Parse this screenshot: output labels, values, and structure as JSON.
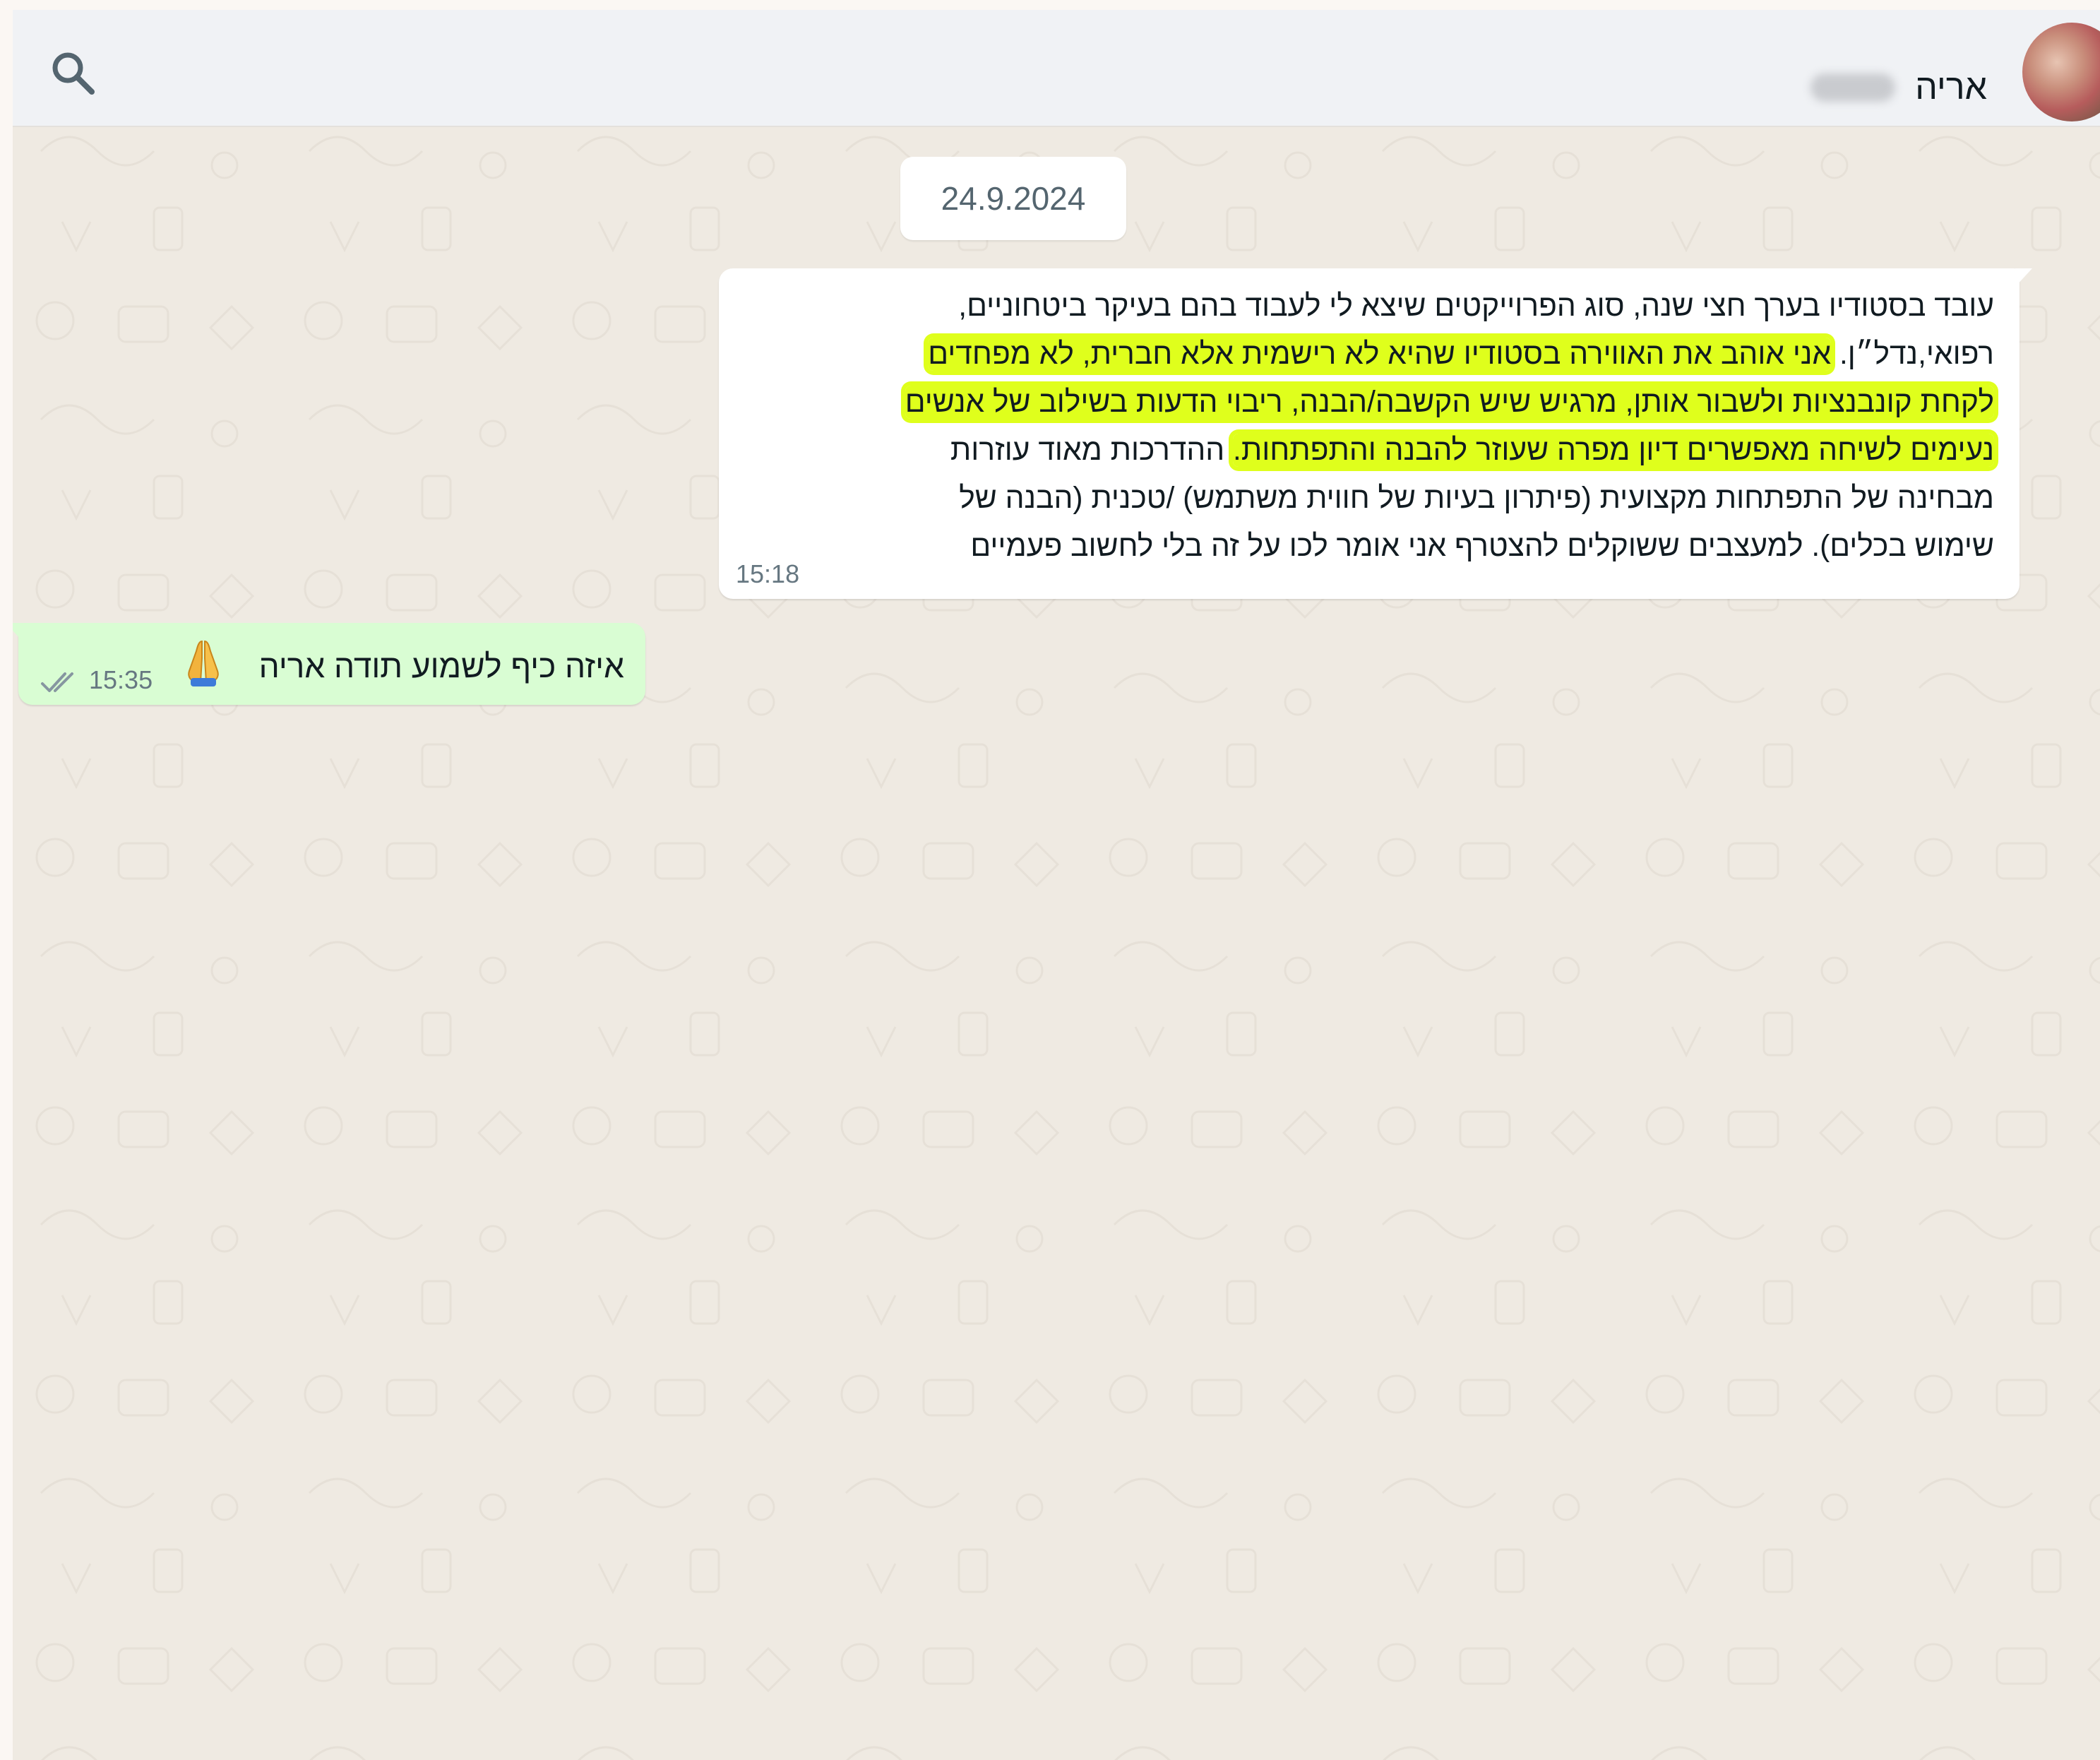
{
  "header": {
    "contact_name": "אריה",
    "search_icon": "search-icon",
    "avatar": "contact-avatar"
  },
  "chat": {
    "date_separator": "24.9.2024",
    "incoming_message": {
      "lines": [
        [
          {
            "text": "עובד בסטודיו בערך חצי שנה, סוג הפרוייקטים שיצא לי לעבוד בהם בעיקר ביטחוניים,",
            "highlight": false
          }
        ],
        [
          {
            "text": "רפואי,נדל״ן. ",
            "highlight": false
          },
          {
            "text": "אני אוהב את האווירה בסטודיו שהיא לא רישמית אלא חברית, לא מפחדים",
            "highlight": true
          }
        ],
        [
          {
            "text": "לקחת קונבנציות ולשבור אותן, מרגיש שיש הקשבה/הבנה, ריבוי הדעות בשילוב של אנשים",
            "highlight": true
          }
        ],
        [
          {
            "text": "נעימים לשיחה מאפשרים דיון מפרה שעוזר להבנה והתפתחות.",
            "highlight": true
          },
          {
            "text": " ההדרכות מאוד עוזרות",
            "highlight": false
          }
        ],
        [
          {
            "text": "מבחינה של התפתחות מקצועית (פיתרון בעיות של חווית משתמש) /טכנית (הבנה של",
            "highlight": false
          }
        ],
        [
          {
            "text": "שימוש בכלים). למעצבים ששוקלים להצטרף אני אומר לכו על זה בלי לחשוב פעמיים",
            "highlight": false
          }
        ]
      ],
      "time": "15:18"
    },
    "outgoing_message": {
      "text": "איזה כיף לשמוע תודה אריה",
      "emoji": "folded-hands-emoji",
      "time": "15:35",
      "status": "read"
    }
  },
  "colors": {
    "header_bg": "#f0f2f5",
    "chat_bg": "#efeae2",
    "incoming_bubble": "#ffffff",
    "outgoing_bubble": "#d9fdd3",
    "highlight": "#dfff1c",
    "timestamp": "#667781"
  }
}
